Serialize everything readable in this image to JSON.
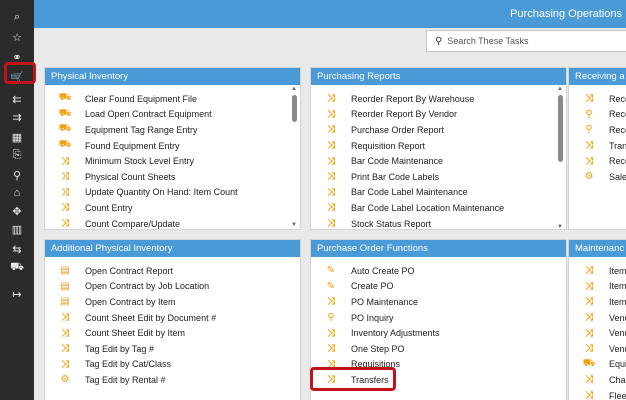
{
  "header": {
    "title": "Purchasing Operations"
  },
  "search": {
    "placeholder": "Search These Tasks"
  },
  "sidebar": {
    "items": [
      {
        "name": "search-icon",
        "glyph": "⌕"
      },
      {
        "name": "star-icon",
        "glyph": "☆"
      },
      {
        "name": "glasses-icon",
        "glyph": "⚭"
      },
      {
        "name": "cart-icon",
        "glyph": "🛒"
      },
      {
        "name": "inbox-left-icon",
        "glyph": "⇇"
      },
      {
        "name": "inbox-right-icon",
        "glyph": "⇉"
      },
      {
        "name": "calculator-icon",
        "glyph": "▦"
      },
      {
        "name": "doc-search-icon",
        "glyph": "⎘"
      },
      {
        "name": "wrench-icon",
        "glyph": "⚲"
      },
      {
        "name": "home-icon",
        "glyph": "⌂"
      },
      {
        "name": "move-icon",
        "glyph": "✥"
      },
      {
        "name": "trash-icon",
        "glyph": "▥"
      },
      {
        "name": "transfer-icon",
        "glyph": "⇆"
      },
      {
        "name": "truck-icon",
        "glyph": "⛟"
      },
      {
        "name": "logout-icon",
        "glyph": "↦"
      }
    ]
  },
  "panels": {
    "physical_inventory": {
      "title": "Physical Inventory",
      "items": [
        {
          "icon": "truck",
          "label": "Clear Found Equipment File"
        },
        {
          "icon": "truck",
          "label": "Load Open Contract Equipment"
        },
        {
          "icon": "truck",
          "label": "Equipment Tag Range Entry"
        },
        {
          "icon": "truck",
          "label": "Found Equipment Entry"
        },
        {
          "icon": "shuffle",
          "label": "Minimum Stock Level Entry"
        },
        {
          "icon": "shuffle",
          "label": "Physical Count Sheets"
        },
        {
          "icon": "shuffle",
          "label": "Update Quantity On Hand: Item Count"
        },
        {
          "icon": "shuffle",
          "label": "Count Entry"
        },
        {
          "icon": "shuffle",
          "label": "Count Compare/Update"
        }
      ]
    },
    "purchasing_reports": {
      "title": "Purchasing Reports",
      "items": [
        {
          "icon": "shuffle",
          "label": "Reorder Report By Warehouse"
        },
        {
          "icon": "shuffle",
          "label": "Reorder Report By Vendor"
        },
        {
          "icon": "shuffle",
          "label": "Purchase Order Report"
        },
        {
          "icon": "shuffle",
          "label": "Requisition Report"
        },
        {
          "icon": "shuffle",
          "label": "Bar Code Maintenance"
        },
        {
          "icon": "shuffle",
          "label": "Print Bar Code Labels"
        },
        {
          "icon": "shuffle",
          "label": "Bar Code Label Maintenance"
        },
        {
          "icon": "shuffle",
          "label": "Bar Code Label Location Maintenance"
        },
        {
          "icon": "shuffle",
          "label": "Stock Status Report"
        }
      ]
    },
    "receiving": {
      "title": "Receiving a",
      "items": [
        {
          "icon": "shuffle",
          "label": "Rece"
        },
        {
          "icon": "search",
          "label": "Rece"
        },
        {
          "icon": "search",
          "label": "Rece"
        },
        {
          "icon": "shuffle",
          "label": "Trans"
        },
        {
          "icon": "shuffle",
          "label": "Rece"
        },
        {
          "icon": "gear",
          "label": "Sales"
        }
      ]
    },
    "additional_physical_inventory": {
      "title": "Additional Physical Inventory",
      "items": [
        {
          "icon": "doc",
          "label": "Open Contract Report"
        },
        {
          "icon": "doc",
          "label": "Open Contract by Job Location"
        },
        {
          "icon": "doc",
          "label": "Open Contract by Item"
        },
        {
          "icon": "shuffle",
          "label": "Count Sheet Edit by Document #"
        },
        {
          "icon": "shuffle",
          "label": "Count Sheet Edit by Item"
        },
        {
          "icon": "shuffle",
          "label": "Tag Edit by Tag #"
        },
        {
          "icon": "shuffle",
          "label": "Tag Edit by Cat/Class"
        },
        {
          "icon": "gear",
          "label": "Tag Edit by Rental #"
        }
      ]
    },
    "purchase_order_functions": {
      "title": "Purchase Order Functions",
      "items": [
        {
          "icon": "pen",
          "label": "Auto Create PO"
        },
        {
          "icon": "pen",
          "label": "Create PO"
        },
        {
          "icon": "shuffle",
          "label": "PO Maintenance"
        },
        {
          "icon": "search",
          "label": "PO Inquiry"
        },
        {
          "icon": "shuffle",
          "label": "Inventory Adjustments"
        },
        {
          "icon": "shuffle",
          "label": "One Step PO"
        },
        {
          "icon": "shuffle",
          "label": "Requisitions"
        },
        {
          "icon": "shuffle",
          "label": "Transfers"
        }
      ]
    },
    "maintenance": {
      "title": "Maintenanc",
      "items": [
        {
          "icon": "shuffle",
          "label": "Item"
        },
        {
          "icon": "shuffle",
          "label": "Item"
        },
        {
          "icon": "shuffle",
          "label": "Item"
        },
        {
          "icon": "shuffle",
          "label": "Vend"
        },
        {
          "icon": "shuffle",
          "label": "Vend"
        },
        {
          "icon": "shuffle",
          "label": "Vend"
        },
        {
          "icon": "truck",
          "label": "Equi"
        },
        {
          "icon": "shuffle",
          "label": "Char"
        },
        {
          "icon": "shuffle",
          "label": "Fleet"
        }
      ]
    }
  }
}
